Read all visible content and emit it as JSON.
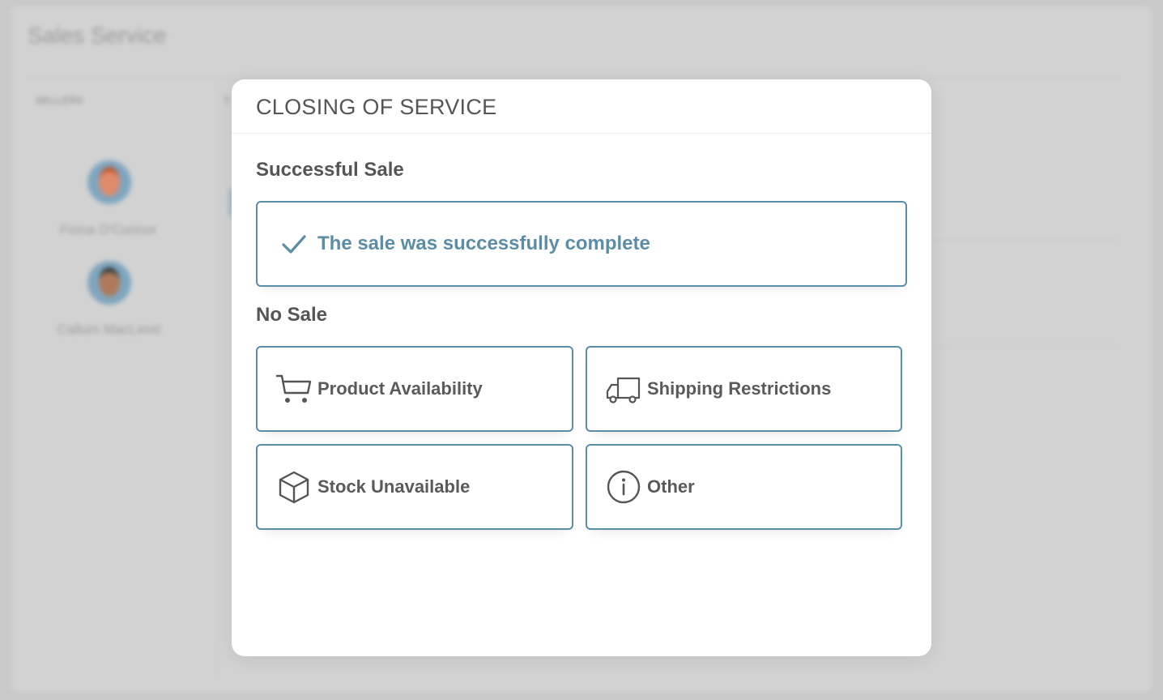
{
  "background": {
    "app_title": "Sales Service",
    "sellers_header": "SELLERS",
    "sellers": [
      {
        "name": "Fiona O'Connor"
      },
      {
        "name": "Callum MacLeod"
      }
    ]
  },
  "modal": {
    "title": "CLOSING OF SERVICE",
    "successful_section": {
      "title": "Successful Sale",
      "option": {
        "label": "The sale was successfully complete",
        "icon": "check-icon"
      }
    },
    "no_sale_section": {
      "title": "No Sale",
      "options": [
        {
          "label": "Product Availability",
          "icon": "cart-icon"
        },
        {
          "label": "Shipping Restrictions",
          "icon": "truck-icon"
        },
        {
          "label": "Stock Unavailable",
          "icon": "box-icon"
        },
        {
          "label": "Other",
          "icon": "info-icon"
        }
      ]
    }
  },
  "colors": {
    "accent": "#5b8ea6",
    "text": "#555555",
    "overlay": "#c9c9c9"
  }
}
